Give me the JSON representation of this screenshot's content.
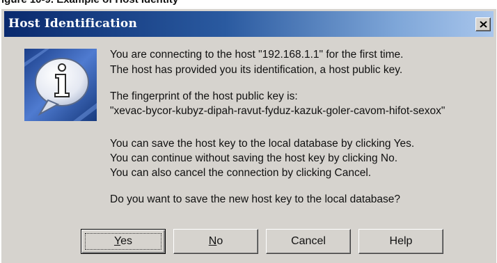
{
  "caption": "igure 10-9. Example of Host Identity",
  "dialog": {
    "title": "Host Identification",
    "close_glyph": "x",
    "message": {
      "line1": "You are connecting to the host \"192.168.1.1\" for the first time.",
      "line2": "The host has provided you its identification, a host public key.",
      "line3": "The fingerprint of the host public key is:",
      "line4": "\"xevac-bycor-kubyz-dipah-ravut-fyduz-kazuk-goler-cavom-hifot-sexox\"",
      "line5": "You can save the host key to the local database by clicking Yes.",
      "line6": "You can continue without saving the host key by clicking No.",
      "line7": "You can also cancel the connection by clicking Cancel.",
      "line8": "Do you want to save the new host key to the local database?"
    },
    "buttons": {
      "yes_first": "Y",
      "yes_rest": "es",
      "no_first": "N",
      "no_rest": "o",
      "cancel": "Cancel",
      "help": "Help"
    },
    "icon": "info-speech-bubble-icon"
  }
}
